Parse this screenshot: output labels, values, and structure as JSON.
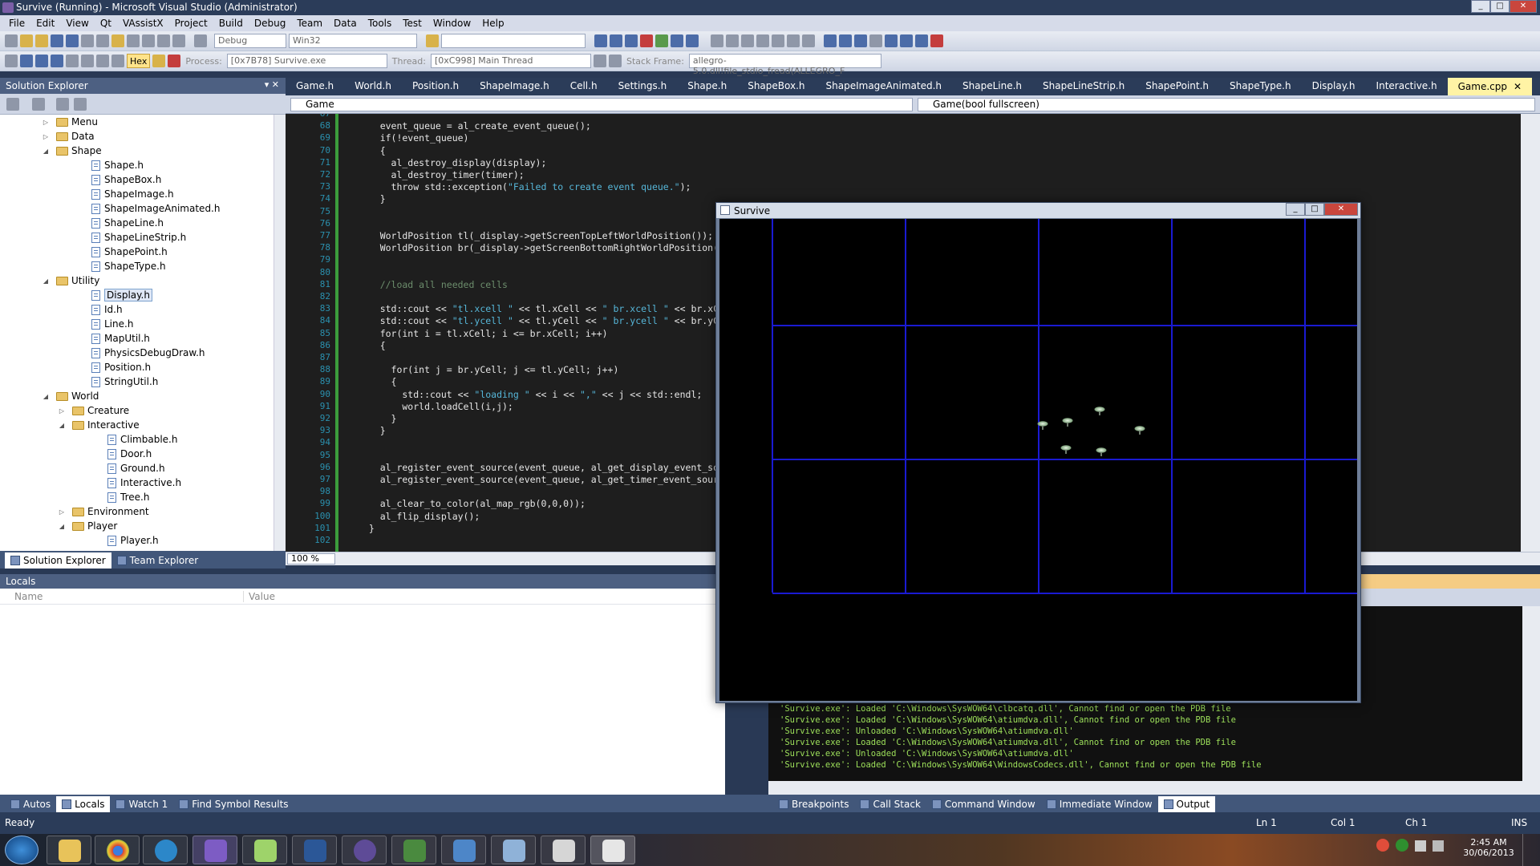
{
  "window": {
    "title": "Survive (Running) - Microsoft Visual Studio (Administrator)",
    "controls": [
      "_",
      "□",
      "✕"
    ]
  },
  "menu": [
    "File",
    "Edit",
    "View",
    "Qt",
    "VAssistX",
    "Project",
    "Build",
    "Debug",
    "Team",
    "Data",
    "Tools",
    "Test",
    "Window",
    "Help"
  ],
  "toolbar1": {
    "config": "Debug",
    "platform": "Win32",
    "search_value": ""
  },
  "toolbar2": {
    "hex_label": "Hex",
    "process_label": "Process:",
    "process_value": "[0x7B78] Survive.exe",
    "thread_label": "Thread:",
    "thread_value": "[0xC998] Main Thread",
    "stack_label": "Stack Frame:",
    "stack_value": "allegro-5.0.dll!file_stdio_fread(ALLEGRO_F"
  },
  "solution_explorer": {
    "title": "Solution Explorer",
    "tree": [
      {
        "label": "Menu",
        "type": "folder",
        "indent": 0,
        "state": "collapsed"
      },
      {
        "label": "Data",
        "type": "folder",
        "indent": 0,
        "state": "collapsed"
      },
      {
        "label": "Shape",
        "type": "folder",
        "indent": 0,
        "state": "expanded"
      },
      {
        "label": "Shape.h",
        "type": "file",
        "indent": 1
      },
      {
        "label": "ShapeBox.h",
        "type": "file",
        "indent": 1
      },
      {
        "label": "ShapeImage.h",
        "type": "file",
        "indent": 1
      },
      {
        "label": "ShapeImageAnimated.h",
        "type": "file",
        "indent": 1
      },
      {
        "label": "ShapeLine.h",
        "type": "file",
        "indent": 1
      },
      {
        "label": "ShapeLineStrip.h",
        "type": "file",
        "indent": 1
      },
      {
        "label": "ShapePoint.h",
        "type": "file",
        "indent": 1
      },
      {
        "label": "ShapeType.h",
        "type": "file",
        "indent": 1
      },
      {
        "label": "Utility",
        "type": "folder",
        "indent": 0,
        "state": "expanded"
      },
      {
        "label": "Display.h",
        "type": "file",
        "indent": 1,
        "selected": true
      },
      {
        "label": "Id.h",
        "type": "file",
        "indent": 1
      },
      {
        "label": "Line.h",
        "type": "file",
        "indent": 1
      },
      {
        "label": "MapUtil.h",
        "type": "file",
        "indent": 1
      },
      {
        "label": "PhysicsDebugDraw.h",
        "type": "file",
        "indent": 1
      },
      {
        "label": "Position.h",
        "type": "file",
        "indent": 1
      },
      {
        "label": "StringUtil.h",
        "type": "file",
        "indent": 1
      },
      {
        "label": "World",
        "type": "folder",
        "indent": 0,
        "state": "expanded"
      },
      {
        "label": "Creature",
        "type": "folder",
        "indent": 1,
        "state": "collapsed"
      },
      {
        "label": "Interactive",
        "type": "folder",
        "indent": 1,
        "state": "expanded"
      },
      {
        "label": "Climbable.h",
        "type": "file",
        "indent": 2
      },
      {
        "label": "Door.h",
        "type": "file",
        "indent": 2
      },
      {
        "label": "Ground.h",
        "type": "file",
        "indent": 2
      },
      {
        "label": "Interactive.h",
        "type": "file",
        "indent": 2
      },
      {
        "label": "Tree.h",
        "type": "file",
        "indent": 2
      },
      {
        "label": "Environment",
        "type": "folder",
        "indent": 1,
        "state": "collapsed"
      },
      {
        "label": "Player",
        "type": "folder",
        "indent": 1,
        "state": "expanded"
      },
      {
        "label": "Player.h",
        "type": "file",
        "indent": 2
      }
    ],
    "tabs": [
      "Solution Explorer",
      "Team Explorer"
    ]
  },
  "doc_tabs": [
    "Game.h",
    "World.h",
    "Position.h",
    "ShapeImage.h",
    "Cell.h",
    "Settings.h",
    "Shape.h",
    "ShapeBox.h",
    "ShapeImageAnimated.h",
    "ShapeLine.h",
    "ShapeLineStrip.h",
    "ShapePoint.h",
    "ShapeType.h",
    "Display.h",
    "Interactive.h",
    "Game.cpp"
  ],
  "nav": {
    "scope": "Game",
    "member": "Game(bool fullscreen)"
  },
  "editor": {
    "zoom": "100 %",
    "lines": [
      {
        "n": "67",
        "code": ""
      },
      {
        "n": "68",
        "code": "    event_queue = al_create_event_queue();"
      },
      {
        "n": "69",
        "code": "    if(!event_queue)"
      },
      {
        "n": "70",
        "code": "    {"
      },
      {
        "n": "71",
        "code": "      al_destroy_display(display);"
      },
      {
        "n": "72",
        "code": "      al_destroy_timer(timer);"
      },
      {
        "n": "73",
        "code": "      throw std::exception(\"Failed to create event queue.\");"
      },
      {
        "n": "74",
        "code": "    }"
      },
      {
        "n": "75",
        "code": ""
      },
      {
        "n": "76",
        "code": ""
      },
      {
        "n": "77",
        "code": "    WorldPosition tl(_display->getScreenTopLeftWorldPosition());"
      },
      {
        "n": "78",
        "code": "    WorldPosition br(_display->getScreenBottomRightWorldPosition());"
      },
      {
        "n": "79",
        "code": ""
      },
      {
        "n": "80",
        "code": ""
      },
      {
        "n": "81",
        "code": "    //load all needed cells"
      },
      {
        "n": "82",
        "code": ""
      },
      {
        "n": "83",
        "code": "    std::cout << \"tl.xcell \" << tl.xCell << \" br.xcell \" << br.xCell"
      },
      {
        "n": "84",
        "code": "    std::cout << \"tl.ycell \" << tl.yCell << \" br.ycell \" << br.yCell"
      },
      {
        "n": "85",
        "code": "    for(int i = tl.xCell; i <= br.xCell; i++)"
      },
      {
        "n": "86",
        "code": "    {"
      },
      {
        "n": "87",
        "code": ""
      },
      {
        "n": "88",
        "code": "      for(int j = br.yCell; j <= tl.yCell; j++)"
      },
      {
        "n": "89",
        "code": "      {"
      },
      {
        "n": "90",
        "code": "        std::cout << \"loading \" << i << \",\" << j << std::endl;"
      },
      {
        "n": "91",
        "code": "        world.loadCell(i,j);"
      },
      {
        "n": "92",
        "code": "      }"
      },
      {
        "n": "93",
        "code": "    }"
      },
      {
        "n": "94",
        "code": ""
      },
      {
        "n": "95",
        "code": ""
      },
      {
        "n": "96",
        "code": "    al_register_event_source(event_queue, al_get_display_event_source"
      },
      {
        "n": "97",
        "code": "    al_register_event_source(event_queue, al_get_timer_event_source"
      },
      {
        "n": "98",
        "code": ""
      },
      {
        "n": "99",
        "code": "    al_clear_to_color(al_map_rgb(0,0,0));"
      },
      {
        "n": "100",
        "code": "    al_flip_display();"
      },
      {
        "n": "101",
        "code": "  }"
      },
      {
        "n": "102",
        "code": ""
      }
    ]
  },
  "locals": {
    "title": "Locals",
    "col_name": "Name",
    "col_value": "Value",
    "tabs": [
      "Autos",
      "Locals",
      "Watch 1",
      "Find Symbol Results"
    ]
  },
  "output": {
    "lines": [
      "'Survive.exe': Loaded 'C:\\Windows\\SysWOW64\\clbcatq.dll', Cannot find or open the PDB file",
      "'Survive.exe': Loaded 'C:\\Windows\\SysWOW64\\atiumdva.dll', Cannot find or open the PDB file",
      "'Survive.exe': Unloaded 'C:\\Windows\\SysWOW64\\atiumdva.dll'",
      "'Survive.exe': Loaded 'C:\\Windows\\SysWOW64\\atiumdva.dll', Cannot find or open the PDB file",
      "'Survive.exe': Unloaded 'C:\\Windows\\SysWOW64\\atiumdva.dll'",
      "'Survive.exe': Loaded 'C:\\Windows\\SysWOW64\\WindowsCodecs.dll', Cannot find or open the PDB file"
    ],
    "tabs": [
      "Breakpoints",
      "Call Stack",
      "Command Window",
      "Immediate Window",
      "Output"
    ]
  },
  "status": {
    "ready": "Ready",
    "ln": "Ln 1",
    "col": "Col 1",
    "ch": "Ch 1",
    "ins": "INS"
  },
  "game_window": {
    "title": "Survive"
  },
  "taskbar": {
    "time": "2:45 AM",
    "date": "30/06/2013"
  }
}
